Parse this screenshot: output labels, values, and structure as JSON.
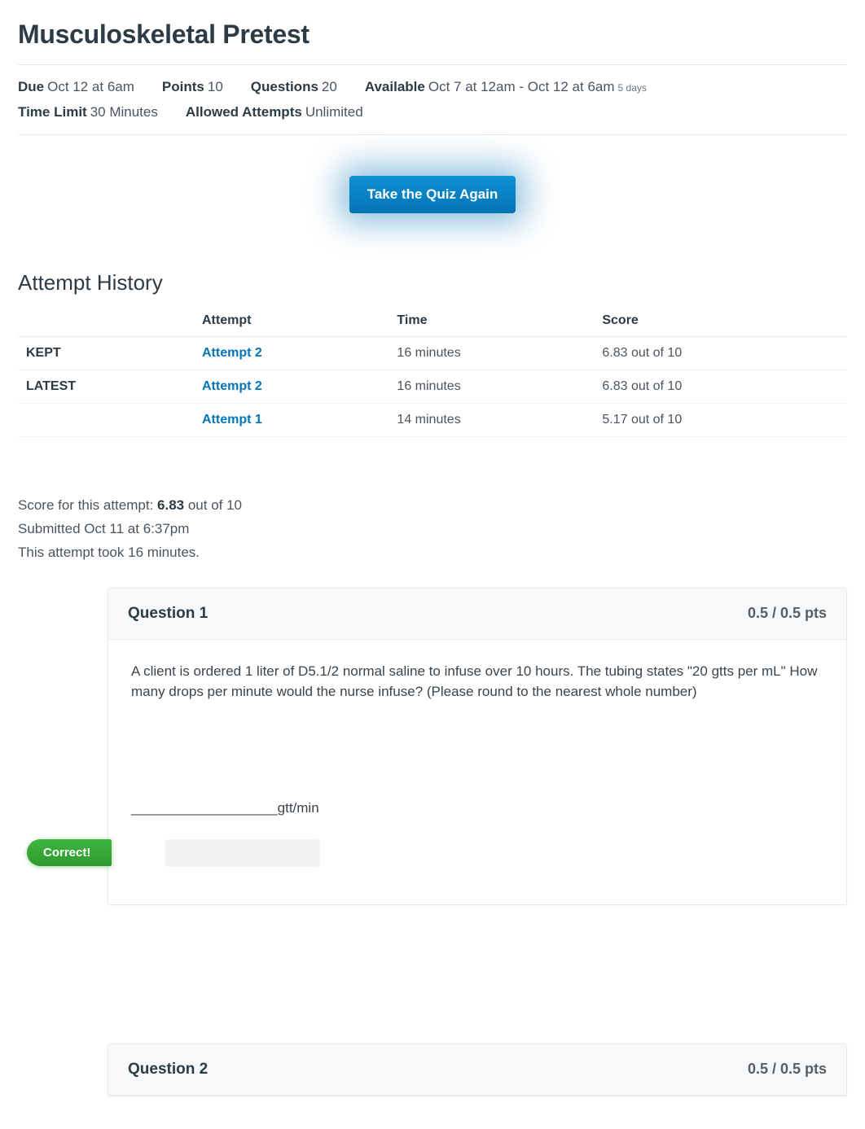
{
  "title": "Musculoskeletal Pretest",
  "meta": {
    "due_label": "Due",
    "due_value": "Oct 12 at 6am",
    "points_label": "Points",
    "points_value": "10",
    "questions_label": "Questions",
    "questions_value": "20",
    "available_label": "Available",
    "available_value": "Oct 7 at 12am - Oct 12 at 6am",
    "available_span": "5 days",
    "timelimit_label": "Time Limit",
    "timelimit_value": "30 Minutes",
    "attempts_label": "Allowed Attempts",
    "attempts_value": "Unlimited"
  },
  "take_button": "Take the Quiz Again",
  "history": {
    "heading": "Attempt History",
    "cols": {
      "attempt": "Attempt",
      "time": "Time",
      "score": "Score"
    },
    "rows": [
      {
        "tag": "KEPT",
        "attempt": "Attempt 2",
        "time": "16 minutes",
        "score": "6.83 out of 10"
      },
      {
        "tag": "LATEST",
        "attempt": "Attempt 2",
        "time": "16 minutes",
        "score": "6.83 out of 10"
      },
      {
        "tag": "",
        "attempt": "Attempt 1",
        "time": "14 minutes",
        "score": "5.17 out of 10"
      }
    ]
  },
  "summary": {
    "line1_prefix": "Score for this attempt: ",
    "line1_bold": "6.83",
    "line1_suffix": " out of 10",
    "line2": "Submitted Oct 11 at 6:37pm",
    "line3": "This attempt took 16 minutes."
  },
  "q1": {
    "title": "Question 1",
    "pts": "0.5 / 0.5 pts",
    "body": "A client is ordered 1 liter of D5.1/2 normal saline to infuse over 10 hours. The tubing states \"20 gtts per mL\" How many drops per minute would the nurse infuse? (Please round to the nearest whole number)",
    "blank": "___________________gtt/min",
    "correct": "Correct!"
  },
  "q2": {
    "title": "Question 2",
    "pts": "0.5 / 0.5 pts"
  }
}
